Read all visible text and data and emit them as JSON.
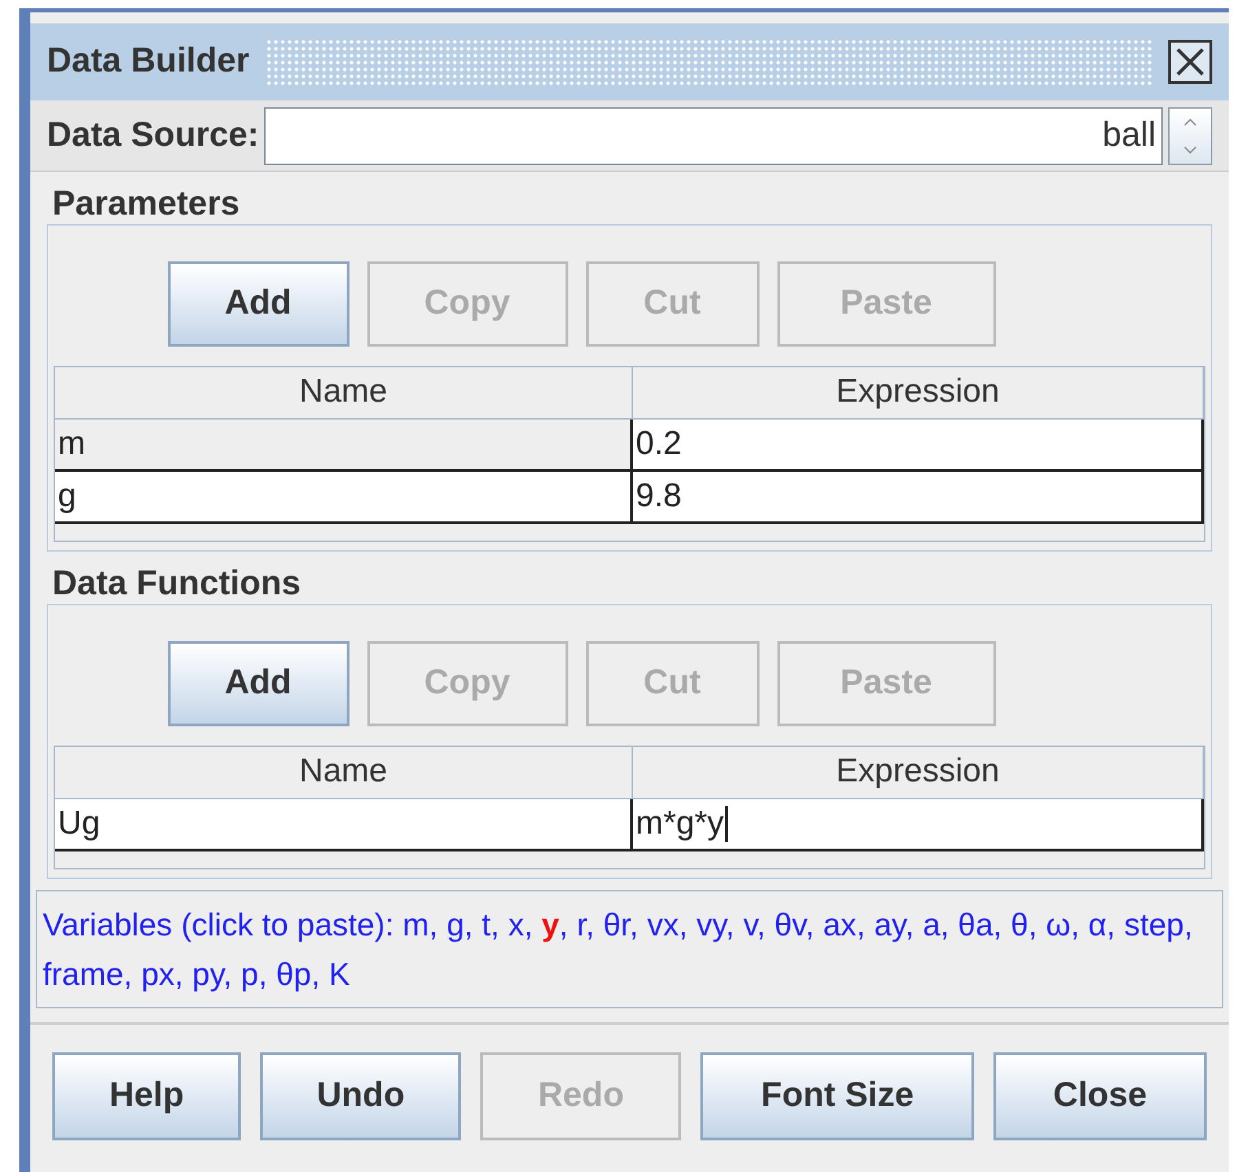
{
  "window": {
    "title": "Data Builder"
  },
  "data_source": {
    "label": "Data Source:",
    "value": "ball"
  },
  "sections": [
    {
      "title": "Parameters",
      "buttons": [
        {
          "label": "Add",
          "disabled": false
        },
        {
          "label": "Copy",
          "disabled": true
        },
        {
          "label": "Cut",
          "disabled": true
        },
        {
          "label": "Paste",
          "disabled": true
        }
      ],
      "columns": [
        "Name",
        "Expression"
      ],
      "rows": [
        {
          "name": "m",
          "expression": "0.2",
          "selected": true,
          "editing": false
        },
        {
          "name": "g",
          "expression": "9.8",
          "selected": false,
          "editing": false
        }
      ]
    },
    {
      "title": "Data Functions",
      "buttons": [
        {
          "label": "Add",
          "disabled": false
        },
        {
          "label": "Copy",
          "disabled": true
        },
        {
          "label": "Cut",
          "disabled": true
        },
        {
          "label": "Paste",
          "disabled": true
        }
      ],
      "columns": [
        "Name",
        "Expression"
      ],
      "rows": [
        {
          "name": "Ug",
          "expression": "m*g*y",
          "selected": false,
          "editing": true
        }
      ]
    }
  ],
  "variables": {
    "label": "Variables (click to paste):",
    "items": [
      {
        "name": "m",
        "punct": ",",
        "highlighted": false
      },
      {
        "name": "g",
        "punct": ",",
        "highlighted": false
      },
      {
        "name": "t",
        "punct": ",",
        "highlighted": false
      },
      {
        "name": "x",
        "punct": ",",
        "highlighted": false
      },
      {
        "name": "y",
        "punct": ",",
        "highlighted": true
      },
      {
        "name": "r",
        "punct": ",",
        "highlighted": false
      },
      {
        "name": "θr",
        "punct": ",",
        "highlighted": false
      },
      {
        "name": "vx",
        "punct": ",",
        "highlighted": false
      },
      {
        "name": "vy",
        "punct": ",",
        "highlighted": false
      },
      {
        "name": "v",
        "punct": ",",
        "highlighted": false
      },
      {
        "name": "θv",
        "punct": ",",
        "highlighted": false
      },
      {
        "name": "ax",
        "punct": ",",
        "highlighted": false
      },
      {
        "name": "ay",
        "punct": ",",
        "highlighted": false
      },
      {
        "name": "a",
        "punct": ",",
        "highlighted": false
      },
      {
        "name": "θa",
        "punct": ",",
        "highlighted": false
      },
      {
        "name": "θ",
        "punct": ",",
        "highlighted": false
      },
      {
        "name": "ω",
        "punct": ",",
        "highlighted": false
      },
      {
        "name": "α",
        "punct": ",",
        "highlighted": false
      },
      {
        "name": "step",
        "punct": ",",
        "highlighted": false
      },
      {
        "name": "frame",
        "punct": ",",
        "highlighted": false
      },
      {
        "name": "px",
        "punct": ",",
        "highlighted": false
      },
      {
        "name": "py",
        "punct": ",",
        "highlighted": false
      },
      {
        "name": "p",
        "punct": ",",
        "highlighted": false
      },
      {
        "name": "θp",
        "punct": ",",
        "highlighted": false
      },
      {
        "name": "K",
        "highlighted": false
      }
    ]
  },
  "footer_buttons": [
    {
      "label": "Help",
      "disabled": false
    },
    {
      "label": "Undo",
      "disabled": false
    },
    {
      "label": "Redo",
      "disabled": true
    },
    {
      "label": "Font Size",
      "disabled": false
    },
    {
      "label": "Close",
      "disabled": false
    }
  ]
}
